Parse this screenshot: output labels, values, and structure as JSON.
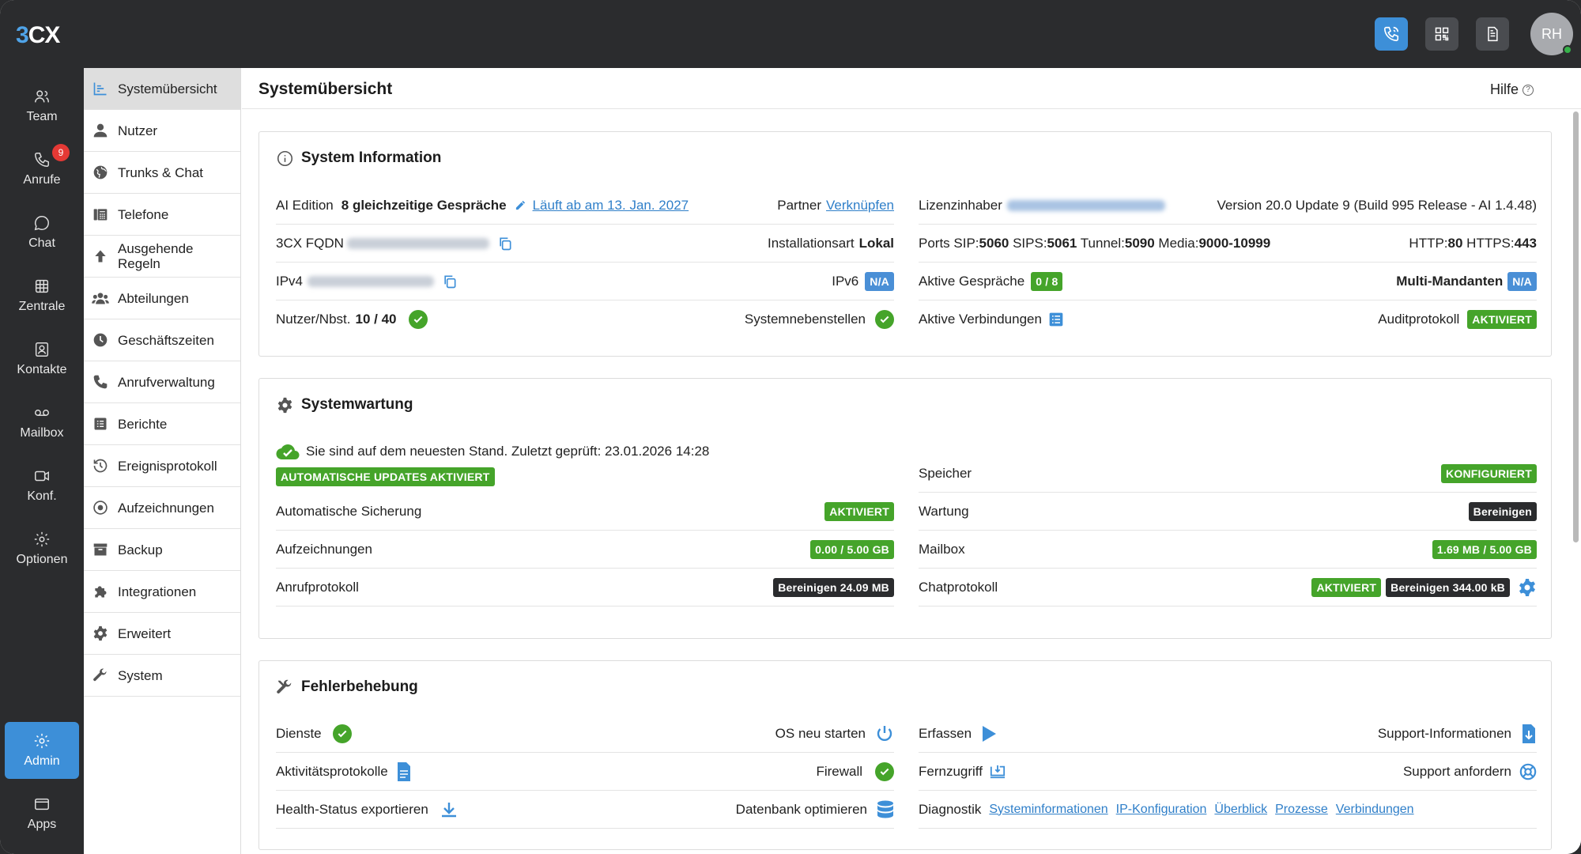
{
  "app": {
    "logo_left": "3",
    "logo_right": "CX"
  },
  "topbar": {
    "avatar_initials": "RH"
  },
  "rail": {
    "items": [
      {
        "label": "Team",
        "icon": "team-icon"
      },
      {
        "label": "Anrufe",
        "icon": "phone-icon",
        "badge": "9"
      },
      {
        "label": "Chat",
        "icon": "chat-icon"
      },
      {
        "label": "Zentrale",
        "icon": "grid-icon"
      },
      {
        "label": "Kontakte",
        "icon": "contacts-icon"
      },
      {
        "label": "Mailbox",
        "icon": "voicemail-icon"
      },
      {
        "label": "Konf.",
        "icon": "video-icon"
      },
      {
        "label": "Optionen",
        "icon": "gear-icon"
      },
      {
        "label": "Admin",
        "icon": "gear-icon"
      },
      {
        "label": "Apps",
        "icon": "apps-icon"
      }
    ]
  },
  "menu": {
    "items": [
      {
        "label": "Systemübersicht"
      },
      {
        "label": "Nutzer"
      },
      {
        "label": "Trunks & Chat"
      },
      {
        "label": "Telefone"
      },
      {
        "label": "Ausgehende Regeln"
      },
      {
        "label": "Abteilungen"
      },
      {
        "label": "Geschäftszeiten"
      },
      {
        "label": "Anrufverwaltung"
      },
      {
        "label": "Berichte"
      },
      {
        "label": "Ereignisprotokoll"
      },
      {
        "label": "Aufzeichnungen"
      },
      {
        "label": "Backup"
      },
      {
        "label": "Integrationen"
      },
      {
        "label": "Erweitert"
      },
      {
        "label": "System"
      }
    ]
  },
  "page": {
    "title": "Systemübersicht",
    "help": "Hilfe"
  },
  "sysinfo": {
    "title": "System Information",
    "edition_label": "AI Edition",
    "edition_value": "8 gleichzeitige Gespräche",
    "expiry": "Läuft ab am 13. Jan. 2027",
    "partner_label": "Partner",
    "partner_link": "Verknüpfen",
    "license_label": "Lizenzinhaber",
    "version": "Version 20.0 Update 9 (Build 995 Release - AI 1.4.48)",
    "fqdn_label": "3CX FQDN",
    "install_label": "Installationsart",
    "install_value": "Lokal",
    "ports_prefix": "Ports SIP:",
    "sip": "5060",
    "sips_label": " SIPS:",
    "sips": "5061",
    "tunnel_label": " Tunnel:",
    "tunnel": "5090",
    "media_label": " Media:",
    "media": "9000-10999",
    "http_label": "HTTP:",
    "http": "80",
    "https_label": " HTTPS:",
    "https": "443",
    "ipv4_label": "IPv4",
    "ipv6_label": "IPv6",
    "na": "N/A",
    "active_calls_label": "Aktive Gespräche",
    "active_calls_value": "0 / 8",
    "multi_tenant_label": "Multi-Mandanten",
    "users_label": "Nutzer/Nbst.",
    "users_value": "10 / 40",
    "sys_ext_label": "Systemnebenstellen",
    "active_conn_label": "Aktive Verbindungen",
    "audit_label": "Auditprotokoll",
    "activated": "AKTIVIERT"
  },
  "maintenance": {
    "title": "Systemwartung",
    "status": "Sie sind auf dem neuesten Stand. Zuletzt geprüft: 23.01.2026 14:28",
    "auto_updates": "AUTOMATISCHE UPDATES AKTIVIERT",
    "storage_label": "Speicher",
    "storage_value": "KONFIGURIERT",
    "backup_label": "Automatische Sicherung",
    "backup_value": "AKTIVIERT",
    "wartung_label": "Wartung",
    "wartung_value": "Bereinigen",
    "recordings_label": "Aufzeichnungen",
    "recordings_value": "0.00 / 5.00 GB",
    "mailbox_label": "Mailbox",
    "mailbox_value": "1.69 MB / 5.00 GB",
    "calllog_label": "Anrufprotokoll",
    "calllog_value": "Bereinigen 24.09 MB",
    "chatlog_label": "Chatprotokoll",
    "chatlog_active": "AKTIVIERT",
    "chatlog_value": "Bereinigen 344.00 kB"
  },
  "troubleshooting": {
    "title": "Fehlerbehebung",
    "services_label": "Dienste",
    "restart_label": "OS neu starten",
    "capture_label": "Erfassen",
    "support_info_label": "Support-Informationen",
    "activity_label": "Aktivitätsprotokolle",
    "firewall_label": "Firewall",
    "remote_label": "Fernzugriff",
    "support_request_label": "Support anfordern",
    "health_label": "Health-Status exportieren",
    "db_label": "Datenbank optimieren",
    "diag_label": "Diagnostik",
    "diag_links": [
      "Systeminformationen",
      "IP-Konfiguration",
      "Überblick",
      "Prozesse",
      "Verbindungen"
    ]
  },
  "colors": {
    "accent": "#3d8fd8",
    "green": "#45a42a",
    "dark": "#2b2c2e"
  }
}
